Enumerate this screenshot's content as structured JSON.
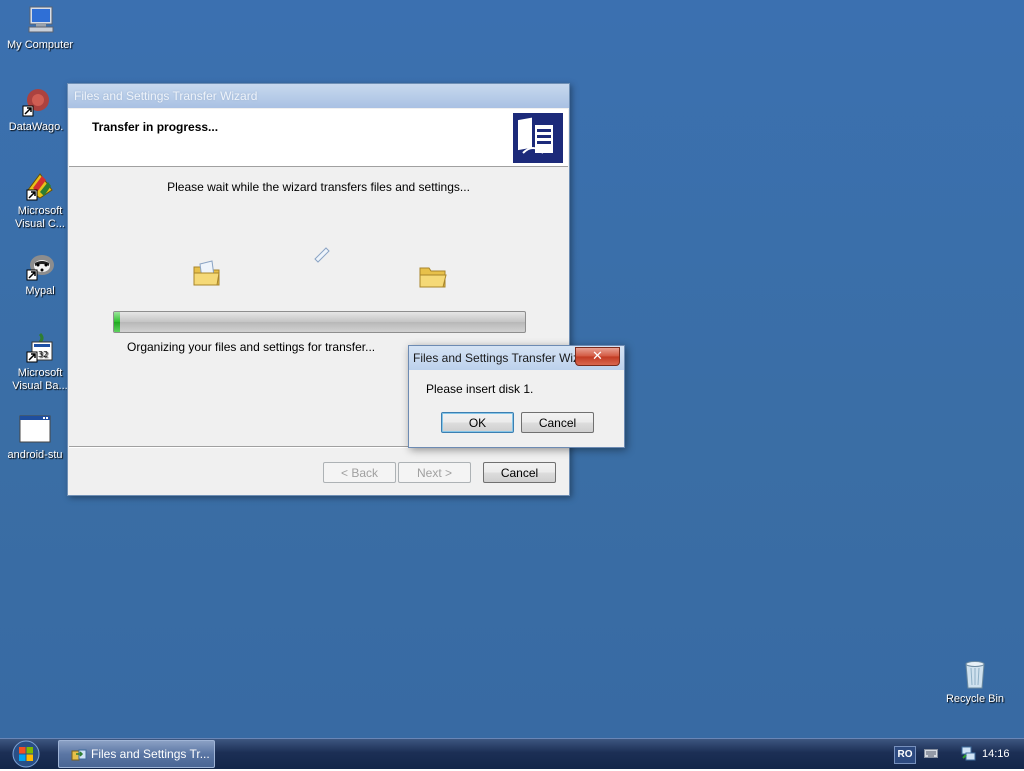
{
  "desktop": {
    "icons": [
      {
        "label": "My Computer",
        "icon": "computer-icon"
      },
      {
        "label": "DataWago.",
        "icon": "datawago-icon"
      },
      {
        "label": "Microsoft Visual C...",
        "line1": "Microsoft",
        "line2": "Visual C...",
        "icon": "visual-c-icon"
      },
      {
        "label": "Mypal",
        "icon": "mypal-icon"
      },
      {
        "label": "Microsoft Visual Ba...",
        "line1": "Microsoft",
        "line2": "Visual Ba...",
        "icon": "visual-basic-icon"
      },
      {
        "label": "android-stu",
        "icon": "android-studio-icon"
      },
      {
        "label": "Recycle Bin",
        "icon": "recycle-bin-icon"
      }
    ]
  },
  "wizard": {
    "title": "Files and Settings Transfer Wizard",
    "header_title": "Transfer in progress...",
    "instruction": "Please wait while the wizard transfers files and settings...",
    "progress_fraction": 0.015,
    "status": "Organizing your files and settings for transfer...",
    "buttons": {
      "back": "< Back",
      "next": "Next >",
      "cancel": "Cancel"
    }
  },
  "msgbox": {
    "title": "Files and Settings Transfer Wiz...",
    "close_glyph": "✕",
    "message": "Please insert disk 1.",
    "ok": "OK",
    "cancel": "Cancel"
  },
  "taskbar": {
    "task_item": "Files and Settings Tr...",
    "language": "RO",
    "clock": "14:16"
  }
}
